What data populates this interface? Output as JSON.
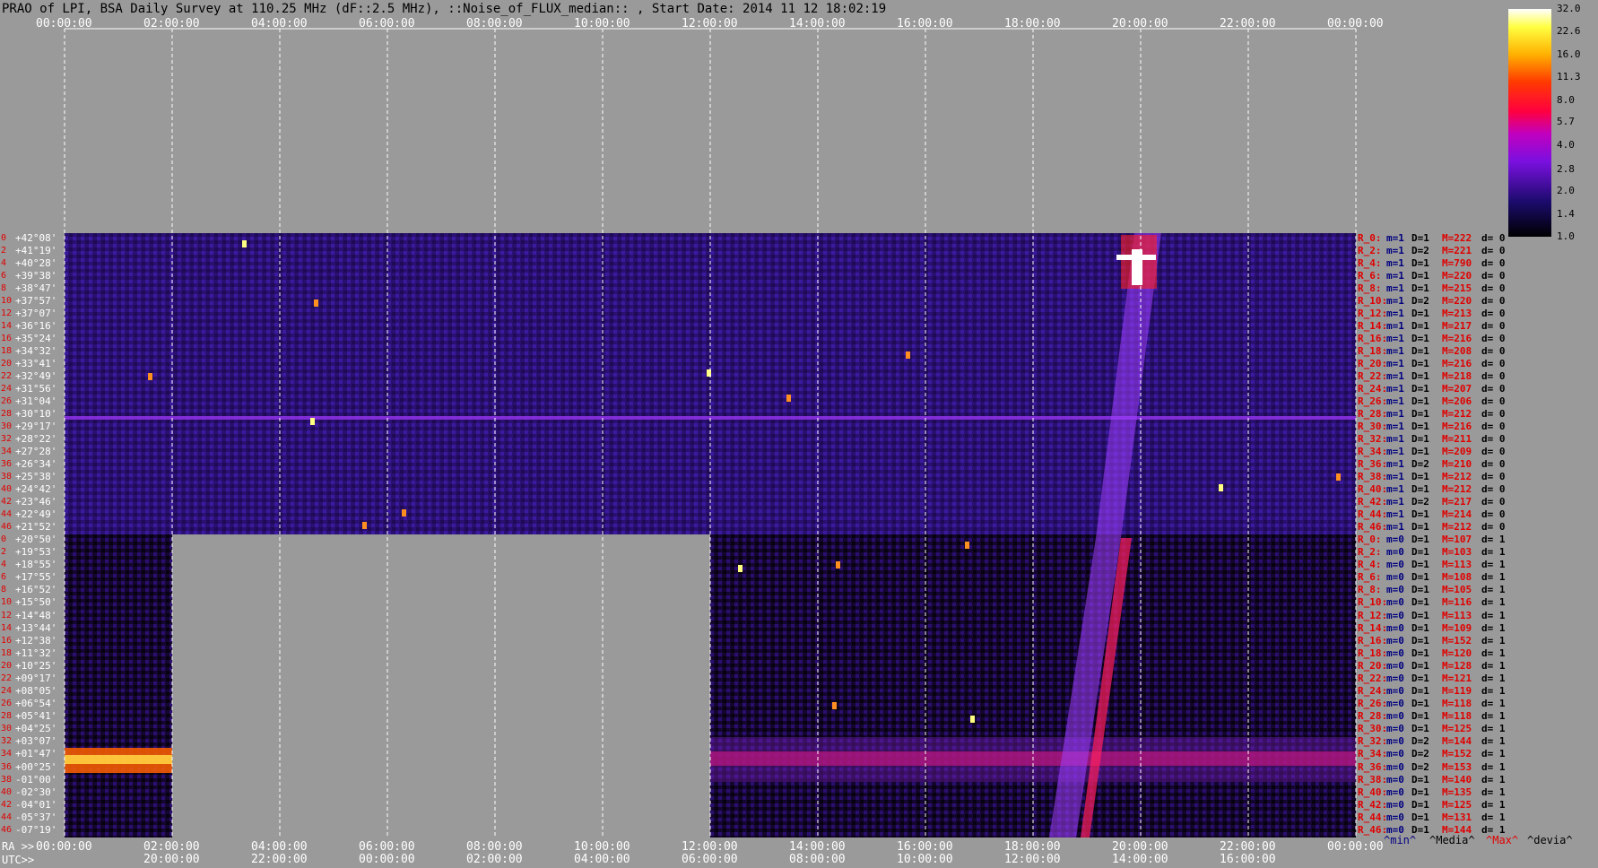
{
  "title": "PRAO of LPI, BSA Daily Survey at 110.25 MHz (dF::2.5 MHz), ::Noise_of_FLUX_median:: , Start Date: 2014 11 12 18:02:19",
  "chart_data": {
    "type": "heatmap",
    "title": "PRAO of LPI, BSA Daily Survey at 110.25 MHz (dF::2.5 MHz), ::Noise_of_FLUX_median:: , Start Date: 2014 11 12 18:02:19",
    "x_top_ticks": [
      "00:00:00",
      "02:00:00",
      "04:00:00",
      "06:00:00",
      "08:00:00",
      "10:00:00",
      "12:00:00",
      "14:00:00",
      "16:00:00",
      "18:00:00",
      "20:00:00",
      "22:00:00",
      "00:00:00"
    ],
    "x_bottom_ra_prefix": "RA >>",
    "x_bottom_ra_ticks": [
      "00:00:00",
      "02:00:00",
      "04:00:00",
      "06:00:00",
      "08:00:00",
      "10:00:00",
      "12:00:00",
      "14:00:00",
      "16:00:00",
      "18:00:00",
      "20:00:00",
      "22:00:00",
      "00:00:00"
    ],
    "x_bottom_utc_prefix": "UTC>>",
    "x_bottom_utc_ticks": [
      "20:00:00",
      "22:00:00",
      "00:00:00",
      "02:00:00",
      "04:00:00",
      "06:00:00",
      "08:00:00",
      "10:00:00",
      "12:00:00",
      "14:00:00",
      "16:00:00"
    ],
    "dec_labels_top": [
      "+42°08'",
      "+41°19'",
      "+40°28'",
      "+39°38'",
      "+38°47'",
      "+37°57'",
      "+37°07'",
      "+36°16'",
      "+35°24'",
      "+34°32'",
      "+33°41'",
      "+32°49'",
      "+31°56'",
      "+31°04'",
      "+30°10'",
      "+29°17'",
      "+28°22'",
      "+27°28'",
      "+26°34'",
      "+25°38'",
      "+24°42'",
      "+23°46'",
      "+22°49'",
      "+21°52'"
    ],
    "dec_labels_bottom": [
      "+20°50'",
      "+19°53'",
      "+18°55'",
      "+17°55'",
      "+16°52'",
      "+15°50'",
      "+14°48'",
      "+13°44'",
      "+12°38'",
      "+11°32'",
      "+10°25'",
      "+09°17'",
      "+08°05'",
      "+06°54'",
      "+05°41'",
      "+04°25'",
      "+03°07'",
      "+01°47'",
      "+00°25'",
      "-01°00'",
      "-02°30'",
      "-04°01'",
      "-05°37'",
      "-07°19'"
    ],
    "side_row_numbers": [
      "0",
      "2",
      "4",
      "6",
      "8",
      "10",
      "12",
      "14",
      "16",
      "18",
      "20",
      "22",
      "24",
      "26",
      "28",
      "30",
      "32",
      "34",
      "36",
      "38",
      "40",
      "42",
      "44",
      "46",
      "0",
      "2",
      "4",
      "6",
      "8",
      "10",
      "12",
      "14",
      "16",
      "18",
      "20",
      "22",
      "24",
      "26",
      "28",
      "30",
      "32",
      "34",
      "36",
      "38",
      "40",
      "42",
      "44",
      "46"
    ],
    "colorbar_ticks": [
      "32.0",
      "22.6",
      "16.0",
      "11.3",
      "8.0",
      "5.7",
      "4.0",
      "2.8",
      "2.0",
      "1.4",
      "1.0"
    ],
    "colorbar_range": [
      1.0,
      32.0
    ],
    "colorbar_scale": "log",
    "row_stats_top": [
      {
        "r": "R_0:",
        "m": "m=1",
        "D": "D=1",
        "M": "M=222",
        "d": "d= 0"
      },
      {
        "r": "R_2:",
        "m": "m=1",
        "D": "D=2",
        "M": "M=221",
        "d": "d= 0"
      },
      {
        "r": "R_4:",
        "m": "m=1",
        "D": "D=1",
        "M": "M=790",
        "d": "d= 0"
      },
      {
        "r": "R_6:",
        "m": "m=1",
        "D": "D=1",
        "M": "M=220",
        "d": "d= 0"
      },
      {
        "r": "R_8:",
        "m": "m=1",
        "D": "D=1",
        "M": "M=215",
        "d": "d= 0"
      },
      {
        "r": "R_10:",
        "m": "m=1",
        "D": "D=2",
        "M": "M=220",
        "d": "d= 0"
      },
      {
        "r": "R_12:",
        "m": "m=1",
        "D": "D=1",
        "M": "M=213",
        "d": "d= 0"
      },
      {
        "r": "R_14:",
        "m": "m=1",
        "D": "D=1",
        "M": "M=217",
        "d": "d= 0"
      },
      {
        "r": "R_16:",
        "m": "m=1",
        "D": "D=1",
        "M": "M=216",
        "d": "d= 0"
      },
      {
        "r": "R_18:",
        "m": "m=1",
        "D": "D=1",
        "M": "M=208",
        "d": "d= 0"
      },
      {
        "r": "R_20:",
        "m": "m=1",
        "D": "D=1",
        "M": "M=216",
        "d": "d= 0"
      },
      {
        "r": "R_22:",
        "m": "m=1",
        "D": "D=1",
        "M": "M=218",
        "d": "d= 0"
      },
      {
        "r": "R_24:",
        "m": "m=1",
        "D": "D=1",
        "M": "M=207",
        "d": "d= 0"
      },
      {
        "r": "R_26:",
        "m": "m=1",
        "D": "D=1",
        "M": "M=206",
        "d": "d= 0"
      },
      {
        "r": "R_28:",
        "m": "m=1",
        "D": "D=1",
        "M": "M=212",
        "d": "d= 0"
      },
      {
        "r": "R_30:",
        "m": "m=1",
        "D": "D=1",
        "M": "M=216",
        "d": "d= 0"
      },
      {
        "r": "R_32:",
        "m": "m=1",
        "D": "D=1",
        "M": "M=211",
        "d": "d= 0"
      },
      {
        "r": "R_34:",
        "m": "m=1",
        "D": "D=1",
        "M": "M=209",
        "d": "d= 0"
      },
      {
        "r": "R_36:",
        "m": "m=1",
        "D": "D=2",
        "M": "M=210",
        "d": "d= 0"
      },
      {
        "r": "R_38:",
        "m": "m=1",
        "D": "D=1",
        "M": "M=212",
        "d": "d= 0"
      },
      {
        "r": "R_40:",
        "m": "m=1",
        "D": "D=1",
        "M": "M=212",
        "d": "d= 0"
      },
      {
        "r": "R_42:",
        "m": "m=1",
        "D": "D=2",
        "M": "M=217",
        "d": "d= 0"
      },
      {
        "r": "R_44:",
        "m": "m=1",
        "D": "D=1",
        "M": "M=214",
        "d": "d= 0"
      },
      {
        "r": "R_46:",
        "m": "m=1",
        "D": "D=1",
        "M": "M=212",
        "d": "d= 0"
      }
    ],
    "row_stats_bottom": [
      {
        "r": "R_0:",
        "m": "m=0",
        "D": "D=1",
        "M": "M=107",
        "d": "d= 1"
      },
      {
        "r": "R_2:",
        "m": "m=0",
        "D": "D=1",
        "M": "M=103",
        "d": "d= 1"
      },
      {
        "r": "R_4:",
        "m": "m=0",
        "D": "D=1",
        "M": "M=113",
        "d": "d= 1"
      },
      {
        "r": "R_6:",
        "m": "m=0",
        "D": "D=1",
        "M": "M=108",
        "d": "d= 1"
      },
      {
        "r": "R_8:",
        "m": "m=0",
        "D": "D=1",
        "M": "M=105",
        "d": "d= 1"
      },
      {
        "r": "R_10:",
        "m": "m=0",
        "D": "D=1",
        "M": "M=116",
        "d": "d= 1"
      },
      {
        "r": "R_12:",
        "m": "m=0",
        "D": "D=1",
        "M": "M=113",
        "d": "d= 1"
      },
      {
        "r": "R_14:",
        "m": "m=0",
        "D": "D=1",
        "M": "M=109",
        "d": "d= 1"
      },
      {
        "r": "R_16:",
        "m": "m=0",
        "D": "D=1",
        "M": "M=152",
        "d": "d= 1"
      },
      {
        "r": "R_18:",
        "m": "m=0",
        "D": "D=1",
        "M": "M=120",
        "d": "d= 1"
      },
      {
        "r": "R_20:",
        "m": "m=0",
        "D": "D=1",
        "M": "M=128",
        "d": "d= 1"
      },
      {
        "r": "R_22:",
        "m": "m=0",
        "D": "D=1",
        "M": "M=121",
        "d": "d= 1"
      },
      {
        "r": "R_24:",
        "m": "m=0",
        "D": "D=1",
        "M": "M=119",
        "d": "d= 1"
      },
      {
        "r": "R_26:",
        "m": "m=0",
        "D": "D=1",
        "M": "M=118",
        "d": "d= 1"
      },
      {
        "r": "R_28:",
        "m": "m=0",
        "D": "D=1",
        "M": "M=118",
        "d": "d= 1"
      },
      {
        "r": "R_30:",
        "m": "m=0",
        "D": "D=1",
        "M": "M=125",
        "d": "d= 1"
      },
      {
        "r": "R_32:",
        "m": "m=0",
        "D": "D=2",
        "M": "M=144",
        "d": "d= 1"
      },
      {
        "r": "R_34:",
        "m": "m=0",
        "D": "D=2",
        "M": "M=152",
        "d": "d= 1"
      },
      {
        "r": "R_36:",
        "m": "m=0",
        "D": "D=2",
        "M": "M=153",
        "d": "d= 1"
      },
      {
        "r": "R_38:",
        "m": "m=0",
        "D": "D=1",
        "M": "M=140",
        "d": "d= 1"
      },
      {
        "r": "R_40:",
        "m": "m=0",
        "D": "D=1",
        "M": "M=135",
        "d": "d= 1"
      },
      {
        "r": "R_42:",
        "m": "m=0",
        "D": "D=1",
        "M": "M=125",
        "d": "d= 1"
      },
      {
        "r": "R_44:",
        "m": "m=0",
        "D": "D=1",
        "M": "M=131",
        "d": "d= 1"
      },
      {
        "r": "R_46:",
        "m": "m=0",
        "D": "D=1",
        "M": "M=144",
        "d": "d= 1"
      }
    ],
    "footer_legend": [
      "^min^",
      "^Media^",
      "^Max^",
      "^devia^"
    ],
    "colors": {
      "background": "#9a9a9a",
      "red_text": "#e00000",
      "navy_text": "#000080",
      "grid_line": "#ffffff"
    }
  }
}
